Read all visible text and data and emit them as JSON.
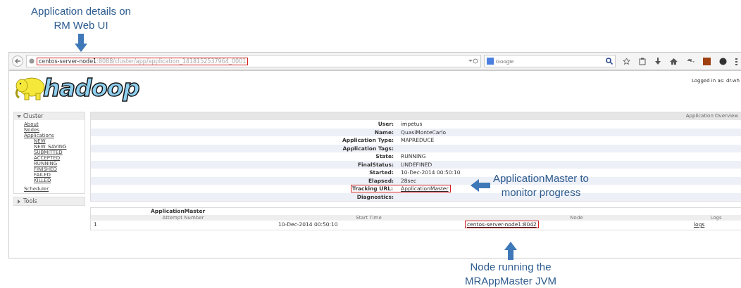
{
  "annotations": [
    {
      "lines": [
        "Application details on",
        "RM Web UI"
      ]
    },
    {
      "lines": [
        "ApplicationMaster to",
        "monitor progress"
      ]
    },
    {
      "lines": [
        "Node running the",
        "MRAppMaster JVM"
      ]
    }
  ],
  "browser": {
    "url_host": "centos-server-node1",
    "url_path": ":8088/cluster/app/application_1418152537964_0001",
    "url_highlighted": true,
    "search_placeholder": "Google"
  },
  "page": {
    "logo_text": "hadoop",
    "logged_in": "Logged in as: dr.wh"
  },
  "sidebar": [
    {
      "label": "Cluster",
      "expanded": true,
      "items": [
        {
          "label": "About"
        },
        {
          "label": "Nodes"
        },
        {
          "label": "Applications",
          "children": [
            {
              "label": "NEW"
            },
            {
              "label": "NEW_SAVING"
            },
            {
              "label": "SUBMITTED"
            },
            {
              "label": "ACCEPTED"
            },
            {
              "label": "RUNNING"
            },
            {
              "label": "FINISHED"
            },
            {
              "label": "FAILED"
            },
            {
              "label": "KILLED"
            }
          ]
        },
        {
          "label": "Scheduler"
        }
      ]
    },
    {
      "label": "Tools",
      "expanded": false
    }
  ],
  "overview": {
    "title": "Application Overview",
    "rows": [
      {
        "label": "User:",
        "value": "impetus",
        "kind": "text",
        "highlighted": false
      },
      {
        "label": "Name:",
        "value": "QuasiMonteCarlo",
        "kind": "text",
        "highlighted": false
      },
      {
        "label": "Application Type:",
        "value": "MAPREDUCE",
        "kind": "text",
        "highlighted": false
      },
      {
        "label": "Application Tags:",
        "value": "",
        "kind": "text",
        "highlighted": false
      },
      {
        "label": "State:",
        "value": "RUNNING",
        "kind": "text",
        "highlighted": false
      },
      {
        "label": "FinalStatus:",
        "value": "UNDEFINED",
        "kind": "text",
        "highlighted": false
      },
      {
        "label": "Started:",
        "value": "10-Dec-2014 00:50:10",
        "kind": "text",
        "highlighted": false
      },
      {
        "label": "Elapsed:",
        "value": "28sec",
        "kind": "text",
        "highlighted": false
      },
      {
        "label": "Tracking URL:",
        "value": "ApplicationMaster",
        "kind": "link",
        "highlighted": true
      },
      {
        "label": "Diagnostics:",
        "value": "",
        "kind": "text",
        "highlighted": false
      }
    ]
  },
  "attempts": {
    "title": "ApplicationMaster",
    "columns": [
      "Attempt Number",
      "Start Time",
      "Node",
      "Logs"
    ],
    "rows": [
      {
        "attempt": "1",
        "start_time": "10-Dec-2014 00:50:10",
        "node": "centos-server-node1:8042",
        "node_highlighted": true,
        "logs": "logs"
      }
    ]
  }
}
